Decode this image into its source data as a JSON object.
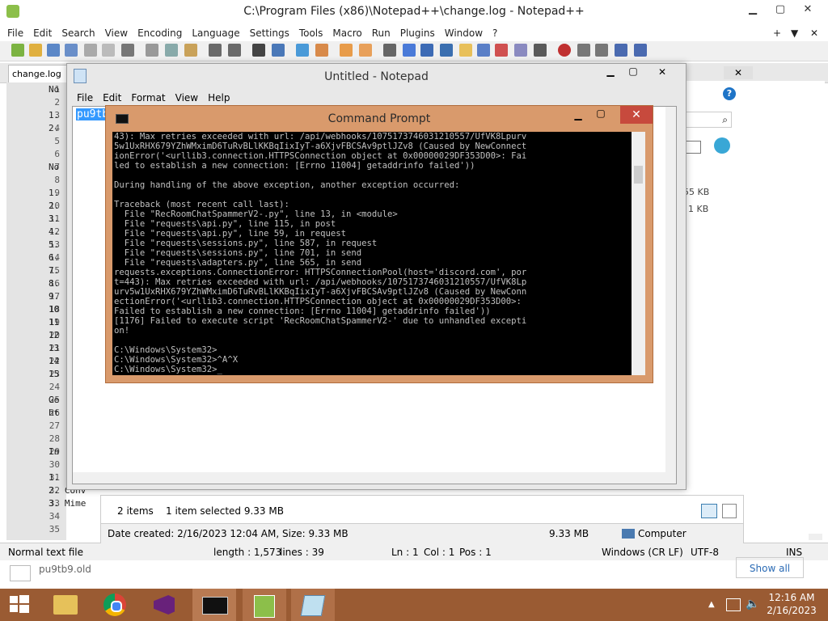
{
  "npp": {
    "title": "C:\\Program Files (x86)\\Notepad++\\change.log - Notepad++",
    "menu": [
      "File",
      "Edit",
      "Search",
      "View",
      "Encoding",
      "Language",
      "Settings",
      "Tools",
      "Macro",
      "Run",
      "Plugins",
      "Window",
      "?"
    ],
    "menu_right": [
      "+",
      "▼",
      "✕"
    ],
    "tab_label": "change.log",
    "line_numbers": [
      "1",
      "2",
      "3",
      "4",
      "5",
      "6",
      "7",
      "8",
      "9",
      "10",
      "11",
      "12",
      "13",
      "14",
      "15",
      "16",
      "17",
      "18",
      "19",
      "20",
      "21",
      "22",
      "23",
      "24",
      "25",
      "26",
      "27",
      "28",
      "29",
      "30",
      "31",
      "32",
      "33",
      "34",
      "35"
    ],
    "code_lines": [
      "No",
      "",
      "1.",
      "2.",
      "",
      "",
      "No",
      "",
      "1.",
      "2.",
      "3.",
      "4.",
      "5.",
      "6.",
      "7.",
      "8.",
      "9.",
      "10",
      "11",
      "12",
      "13",
      "14",
      "15",
      "",
      "Ge",
      "ht",
      "",
      "",
      "In",
      "",
      "1.",
      "2.  Conv",
      "3.  Mime",
      "",
      ""
    ],
    "status": {
      "type": "Normal text file",
      "length": "length : 1,573",
      "lines": "lines : 39",
      "ln": "Ln : 1",
      "col": "Col : 1",
      "pos": "Pos : 1",
      "eol": "Windows (CR LF)",
      "enc": "UTF-8",
      "mode": "INS"
    }
  },
  "notepad": {
    "title": "Untitled - Notepad",
    "menu": [
      "File",
      "Edit",
      "Format",
      "View",
      "Help"
    ],
    "selected_text": "pu9tb"
  },
  "explorer": {
    "sizes": [
      "55 KB",
      "1 KB"
    ],
    "items": "2 items",
    "selected": "1 item selected  9.33 MB",
    "details": "Date created: 2/16/2023 12:04 AM, Size: 9.33 MB",
    "size": "9.33 MB",
    "computer": "Computer",
    "strip_file": "pu9tb9.old",
    "strip_right": "Show all"
  },
  "cmd": {
    "title": "Command Prompt",
    "lines": [
      "43): Max retries exceeded with url: /api/webhooks/1075173746031210557/UfVK8Lpurv",
      "5w1UxRHX679YZhWMximD6TuRvBLlKKBqIixIyT-a6XjvFBCSAv9ptlJZv8 (Caused by NewConnect",
      "ionError('<urllib3.connection.HTTPSConnection object at 0x00000029DF353D00>: Fai",
      "led to establish a new connection: [Errno 11004] getaddrinfo failed'))",
      "",
      "During handling of the above exception, another exception occurred:",
      "",
      "Traceback (most recent call last):",
      "  File \"RecRoomChatSpammerV2-.py\", line 13, in <module>",
      "  File \"requests\\api.py\", line 115, in post",
      "  File \"requests\\api.py\", line 59, in request",
      "  File \"requests\\sessions.py\", line 587, in request",
      "  File \"requests\\sessions.py\", line 701, in send",
      "  File \"requests\\adapters.py\", line 565, in send",
      "requests.exceptions.ConnectionError: HTTPSConnectionPool(host='discord.com', por",
      "t=443): Max retries exceeded with url: /api/webhooks/1075173746031210557/UfVK8Lp",
      "urv5w1UxRHX679YZhWMximD6TuRvBLlKKBqIixIyT-a6XjvFBCSAv9ptlJZv8 (Caused by NewConn",
      "ectionError('<urllib3.connection.HTTPSConnection object at 0x00000029DF353D00>:",
      "Failed to establish a new connection: [Errno 11004] getaddrinfo failed'))",
      "[1176] Failed to execute script 'RecRoomChatSpammerV2-' due to unhandled excepti",
      "on!",
      "",
      "C:\\Windows\\System32>",
      "C:\\Windows\\System32>^A^X",
      "C:\\Windows\\System32>_"
    ]
  },
  "taskbar": {
    "time": "12:16 AM",
    "date": "2/16/2023",
    "accent": "#9a5b33"
  }
}
